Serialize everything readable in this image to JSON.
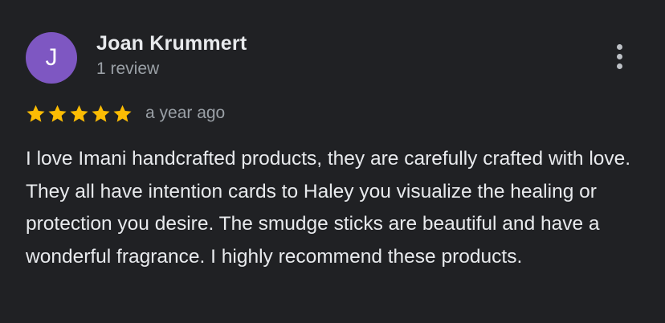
{
  "reviewer": {
    "avatar_letter": "J",
    "avatar_color": "#7e57c2",
    "name": "Joan Krummert",
    "review_count": "1 review"
  },
  "review": {
    "rating": 5,
    "max_rating": 5,
    "time": "a year ago",
    "text": "I love Imani handcrafted products, they are carefully crafted with love. They all have intention cards to Haley you visualize the healing or protection you desire. The smudge sticks are beautiful and have a wonderful fragrance. I highly recommend these products."
  },
  "menu": {
    "icon": "more-vert-icon"
  },
  "colors": {
    "background": "#202124",
    "star": "#fbbc04",
    "primary_text": "#e8eaed",
    "secondary_text": "#9aa0a6"
  }
}
